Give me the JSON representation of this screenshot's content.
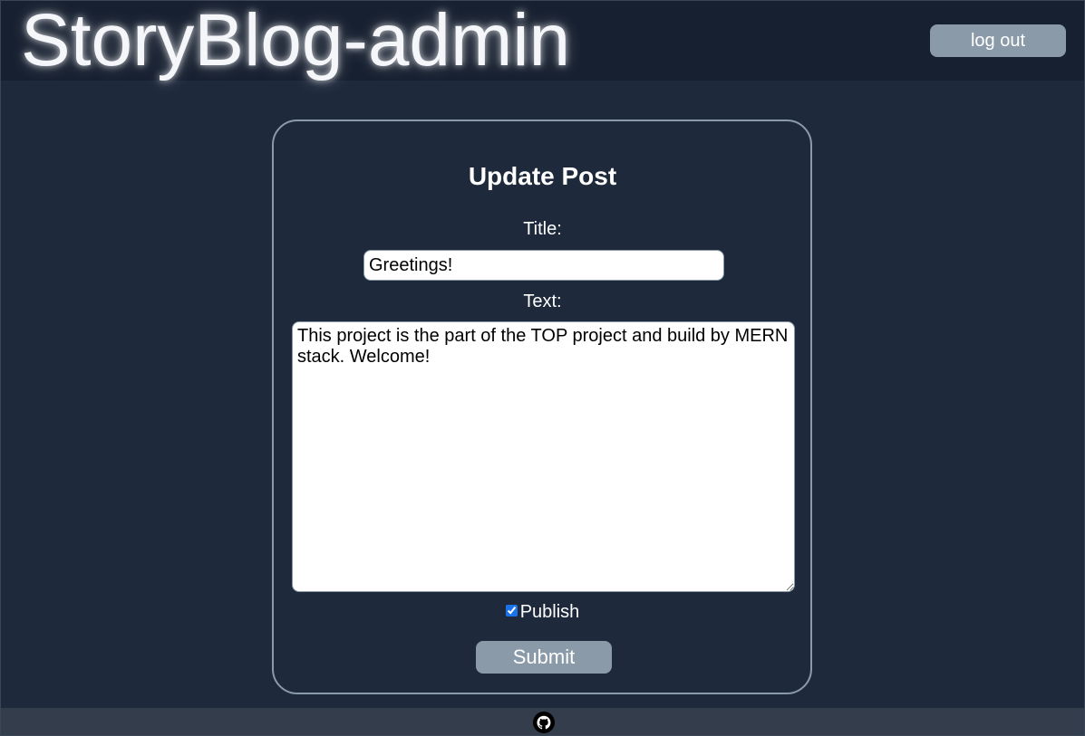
{
  "header": {
    "site_title": "StoryBlog-admin",
    "logout_label": "log out"
  },
  "form": {
    "heading": "Update Post",
    "title_label": "Title:",
    "title_value": "Greetings!",
    "text_label": "Text:",
    "text_value": "This project is the part of the TOP project and build by MERN stack. Welcome!",
    "publish_label": "Publish",
    "publish_checked": true,
    "submit_label": "Submit"
  },
  "footer": {
    "icon": "github-icon"
  },
  "colors": {
    "page_background": "#1e293b",
    "header_background": "#172030",
    "button_background": "#8a9aa8",
    "footer_background": "#333d4b"
  }
}
